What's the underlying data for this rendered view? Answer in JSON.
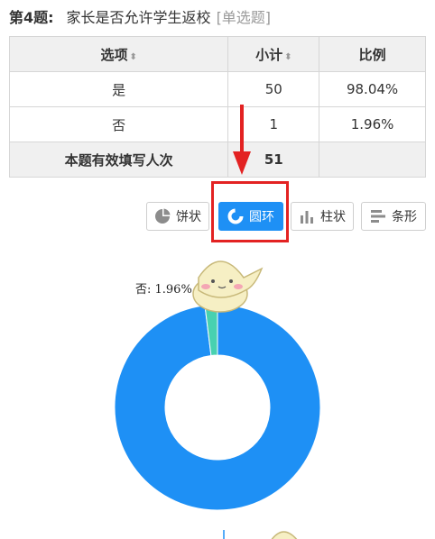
{
  "question": {
    "number": "第4题:",
    "text": "家长是否允许学生返校",
    "type": "[单选题]"
  },
  "table": {
    "headers": [
      "选项",
      "小计",
      "比例"
    ],
    "sort_marker": "⬍",
    "rows": [
      {
        "option": "是",
        "count": "50",
        "ratio": "98.04%"
      },
      {
        "option": "否",
        "count": "1",
        "ratio": "1.96%"
      }
    ],
    "total": {
      "label": "本题有效填写人次",
      "count": "51"
    }
  },
  "chart_tabs": [
    {
      "label": "饼状",
      "icon": "pie-icon",
      "active": false
    },
    {
      "label": "圆环",
      "icon": "ring-icon",
      "active": true
    },
    {
      "label": "柱状",
      "icon": "bar-chart-icon",
      "active": false
    },
    {
      "label": "条形",
      "icon": "bars-horizontal-icon",
      "active": false
    }
  ],
  "colors": {
    "accent": "#1e90f5",
    "highlight": "#e32222",
    "slice_yes": "#1e90f5",
    "slice_no": "#48d1b0"
  },
  "chart_data": {
    "type": "pie",
    "donut": true,
    "categories": [
      "是",
      "否"
    ],
    "values": [
      98.04,
      1.96
    ],
    "counts": [
      50,
      1
    ],
    "labels": [
      "否: 1.96%"
    ]
  }
}
